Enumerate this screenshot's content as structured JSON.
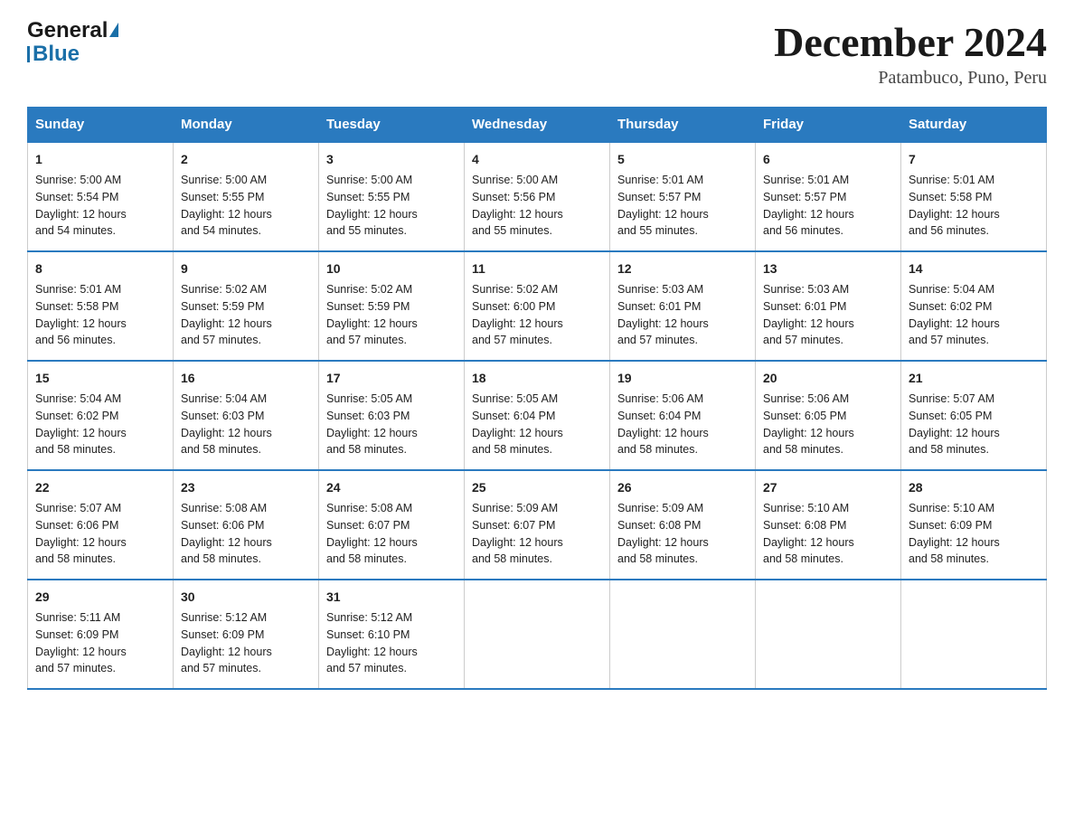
{
  "header": {
    "logo_text_general": "General",
    "logo_text_blue": "Blue",
    "month_title": "December 2024",
    "location": "Patambuco, Puno, Peru"
  },
  "days_of_week": [
    "Sunday",
    "Monday",
    "Tuesday",
    "Wednesday",
    "Thursday",
    "Friday",
    "Saturday"
  ],
  "weeks": [
    [
      {
        "day": "1",
        "sunrise": "5:00 AM",
        "sunset": "5:54 PM",
        "daylight": "12 hours and 54 minutes."
      },
      {
        "day": "2",
        "sunrise": "5:00 AM",
        "sunset": "5:55 PM",
        "daylight": "12 hours and 54 minutes."
      },
      {
        "day": "3",
        "sunrise": "5:00 AM",
        "sunset": "5:55 PM",
        "daylight": "12 hours and 55 minutes."
      },
      {
        "day": "4",
        "sunrise": "5:00 AM",
        "sunset": "5:56 PM",
        "daylight": "12 hours and 55 minutes."
      },
      {
        "day": "5",
        "sunrise": "5:01 AM",
        "sunset": "5:57 PM",
        "daylight": "12 hours and 55 minutes."
      },
      {
        "day": "6",
        "sunrise": "5:01 AM",
        "sunset": "5:57 PM",
        "daylight": "12 hours and 56 minutes."
      },
      {
        "day": "7",
        "sunrise": "5:01 AM",
        "sunset": "5:58 PM",
        "daylight": "12 hours and 56 minutes."
      }
    ],
    [
      {
        "day": "8",
        "sunrise": "5:01 AM",
        "sunset": "5:58 PM",
        "daylight": "12 hours and 56 minutes."
      },
      {
        "day": "9",
        "sunrise": "5:02 AM",
        "sunset": "5:59 PM",
        "daylight": "12 hours and 57 minutes."
      },
      {
        "day": "10",
        "sunrise": "5:02 AM",
        "sunset": "5:59 PM",
        "daylight": "12 hours and 57 minutes."
      },
      {
        "day": "11",
        "sunrise": "5:02 AM",
        "sunset": "6:00 PM",
        "daylight": "12 hours and 57 minutes."
      },
      {
        "day": "12",
        "sunrise": "5:03 AM",
        "sunset": "6:01 PM",
        "daylight": "12 hours and 57 minutes."
      },
      {
        "day": "13",
        "sunrise": "5:03 AM",
        "sunset": "6:01 PM",
        "daylight": "12 hours and 57 minutes."
      },
      {
        "day": "14",
        "sunrise": "5:04 AM",
        "sunset": "6:02 PM",
        "daylight": "12 hours and 57 minutes."
      }
    ],
    [
      {
        "day": "15",
        "sunrise": "5:04 AM",
        "sunset": "6:02 PM",
        "daylight": "12 hours and 58 minutes."
      },
      {
        "day": "16",
        "sunrise": "5:04 AM",
        "sunset": "6:03 PM",
        "daylight": "12 hours and 58 minutes."
      },
      {
        "day": "17",
        "sunrise": "5:05 AM",
        "sunset": "6:03 PM",
        "daylight": "12 hours and 58 minutes."
      },
      {
        "day": "18",
        "sunrise": "5:05 AM",
        "sunset": "6:04 PM",
        "daylight": "12 hours and 58 minutes."
      },
      {
        "day": "19",
        "sunrise": "5:06 AM",
        "sunset": "6:04 PM",
        "daylight": "12 hours and 58 minutes."
      },
      {
        "day": "20",
        "sunrise": "5:06 AM",
        "sunset": "6:05 PM",
        "daylight": "12 hours and 58 minutes."
      },
      {
        "day": "21",
        "sunrise": "5:07 AM",
        "sunset": "6:05 PM",
        "daylight": "12 hours and 58 minutes."
      }
    ],
    [
      {
        "day": "22",
        "sunrise": "5:07 AM",
        "sunset": "6:06 PM",
        "daylight": "12 hours and 58 minutes."
      },
      {
        "day": "23",
        "sunrise": "5:08 AM",
        "sunset": "6:06 PM",
        "daylight": "12 hours and 58 minutes."
      },
      {
        "day": "24",
        "sunrise": "5:08 AM",
        "sunset": "6:07 PM",
        "daylight": "12 hours and 58 minutes."
      },
      {
        "day": "25",
        "sunrise": "5:09 AM",
        "sunset": "6:07 PM",
        "daylight": "12 hours and 58 minutes."
      },
      {
        "day": "26",
        "sunrise": "5:09 AM",
        "sunset": "6:08 PM",
        "daylight": "12 hours and 58 minutes."
      },
      {
        "day": "27",
        "sunrise": "5:10 AM",
        "sunset": "6:08 PM",
        "daylight": "12 hours and 58 minutes."
      },
      {
        "day": "28",
        "sunrise": "5:10 AM",
        "sunset": "6:09 PM",
        "daylight": "12 hours and 58 minutes."
      }
    ],
    [
      {
        "day": "29",
        "sunrise": "5:11 AM",
        "sunset": "6:09 PM",
        "daylight": "12 hours and 57 minutes."
      },
      {
        "day": "30",
        "sunrise": "5:12 AM",
        "sunset": "6:09 PM",
        "daylight": "12 hours and 57 minutes."
      },
      {
        "day": "31",
        "sunrise": "5:12 AM",
        "sunset": "6:10 PM",
        "daylight": "12 hours and 57 minutes."
      },
      null,
      null,
      null,
      null
    ]
  ],
  "labels": {
    "sunrise": "Sunrise:",
    "sunset": "Sunset:",
    "daylight": "Daylight:"
  }
}
